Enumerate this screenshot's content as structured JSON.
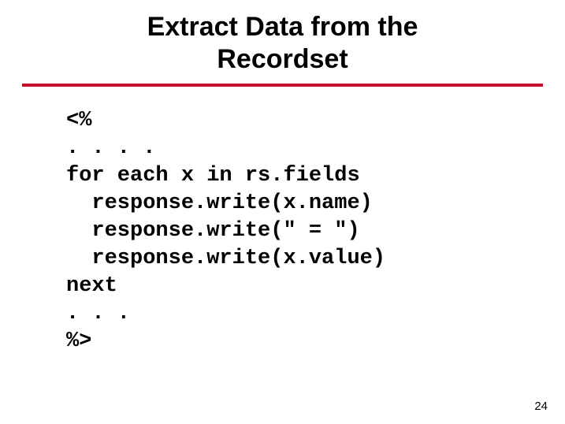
{
  "title_line1": "Extract Data from the",
  "title_line2": "Recordset",
  "code": "<%\n. . . .\nfor each x in rs.fields\n  response.write(x.name)\n  response.write(\" = \")\n  response.write(x.value)\nnext\n. . .\n%>",
  "page_number": "24"
}
